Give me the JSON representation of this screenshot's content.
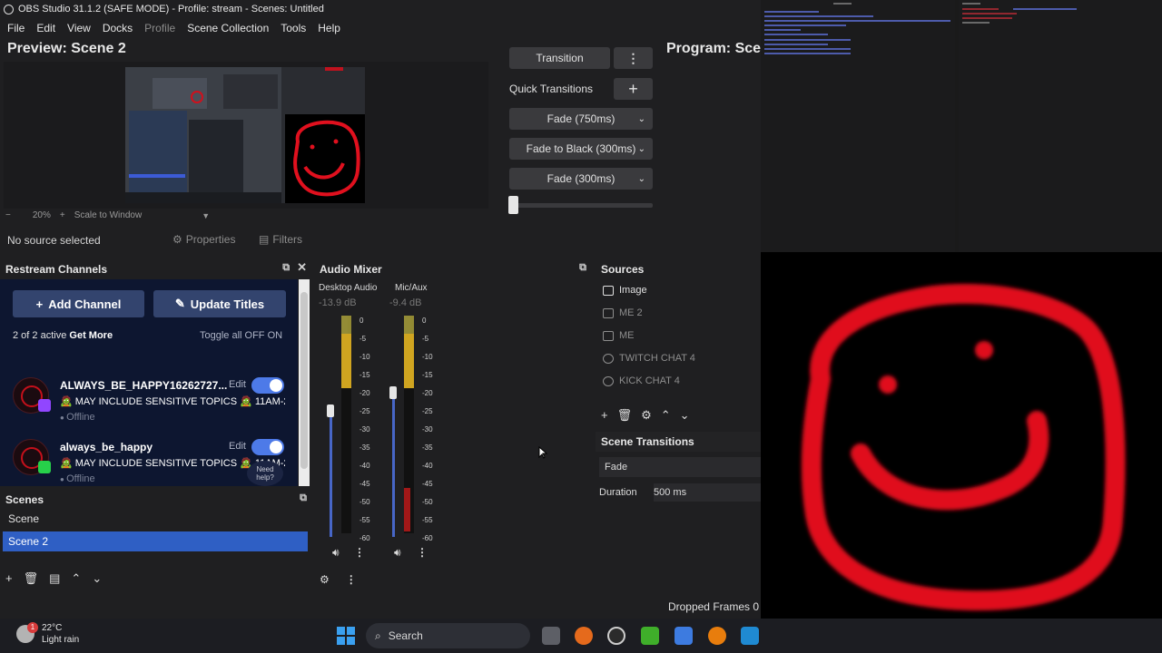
{
  "window": {
    "title": "OBS Studio 31.1.2 (SAFE MODE) - Profile: stream - Scenes: Untitled"
  },
  "menu": [
    "File",
    "Edit",
    "View",
    "Docks",
    "Profile",
    "Scene Collection",
    "Tools",
    "Help"
  ],
  "preview": {
    "title": "Preview: Scene 2",
    "zoom_minus": "−",
    "zoom": "20%",
    "zoom_plus": "+",
    "scale_mode": "Scale to Window"
  },
  "program": {
    "title": "Program: Sce"
  },
  "transitions_panel": {
    "transition_label": "Transition",
    "menu_glyph": "⋮",
    "quick_label": "Quick Transitions",
    "add_glyph": "+",
    "quick": [
      "Fade (750ms)",
      "Fade to Black (300ms)",
      "Fade (300ms)"
    ],
    "tbar_position": 0
  },
  "source_toolbar": {
    "no_source": "No source selected",
    "properties": "Properties",
    "filters": "Filters"
  },
  "restream": {
    "title": "Restream Channels",
    "add_channel": "Add Channel",
    "update_titles": "Update Titles",
    "active_prefix": "2 of 2 active",
    "get_more": "Get More",
    "toggle_all": "Toggle all OFF  ON",
    "channels": [
      {
        "name": "ALWAYS_BE_HAPPY16262727...",
        "edit": "Edit",
        "title": "🧟 MAY INCLUDE SENSITIVE TOPICS 🧟 11AM-2:...",
        "status": "Offline",
        "platform": "twitch",
        "enabled": true
      },
      {
        "name": "always_be_happy",
        "edit": "Edit",
        "title": "🧟 MAY INCLUDE SENSITIVE TOPICS 🧟 11AM-2:...",
        "status": "Offline",
        "platform": "kick",
        "enabled": true
      }
    ],
    "need_help": "Need help?"
  },
  "audio_mixer": {
    "title": "Audio Mixer",
    "channels": [
      {
        "name": "Desktop Audio",
        "db": "-13.9 dB",
        "level_db": -13.9
      },
      {
        "name": "Mic/Aux",
        "db": "-9.4 dB",
        "level_db": -9.4
      }
    ],
    "scale": [
      "0",
      "-5",
      "-10",
      "-15",
      "-20",
      "-25",
      "-30",
      "-35",
      "-40",
      "-45",
      "-50",
      "-55",
      "-60"
    ]
  },
  "sources": {
    "title": "Sources",
    "items": [
      {
        "label": "Image",
        "visible": true
      },
      {
        "label": "ME 2",
        "visible": false
      },
      {
        "label": "ME",
        "visible": false
      },
      {
        "label": "TWITCH CHAT 4",
        "visible": false
      },
      {
        "label": "KICK CHAT 4",
        "visible": false
      }
    ]
  },
  "scene_transitions": {
    "title": "Scene Transitions",
    "selected": "Fade",
    "duration_label": "Duration",
    "duration_value": "500 ms"
  },
  "scenes": {
    "title": "Scenes",
    "items": [
      "Scene",
      "Scene 2"
    ],
    "selected": "Scene 2"
  },
  "status": {
    "dropped_frames": "Dropped Frames 0"
  },
  "taskbar": {
    "weather_temp": "22°C",
    "weather_desc": "Light rain",
    "weather_badge": "1",
    "search": "Search"
  },
  "colors": {
    "accent": "#2f5fc4",
    "restream_bg": "#0d1630",
    "toggle_on": "#4d7ae8",
    "face_red": "#e0101e"
  }
}
